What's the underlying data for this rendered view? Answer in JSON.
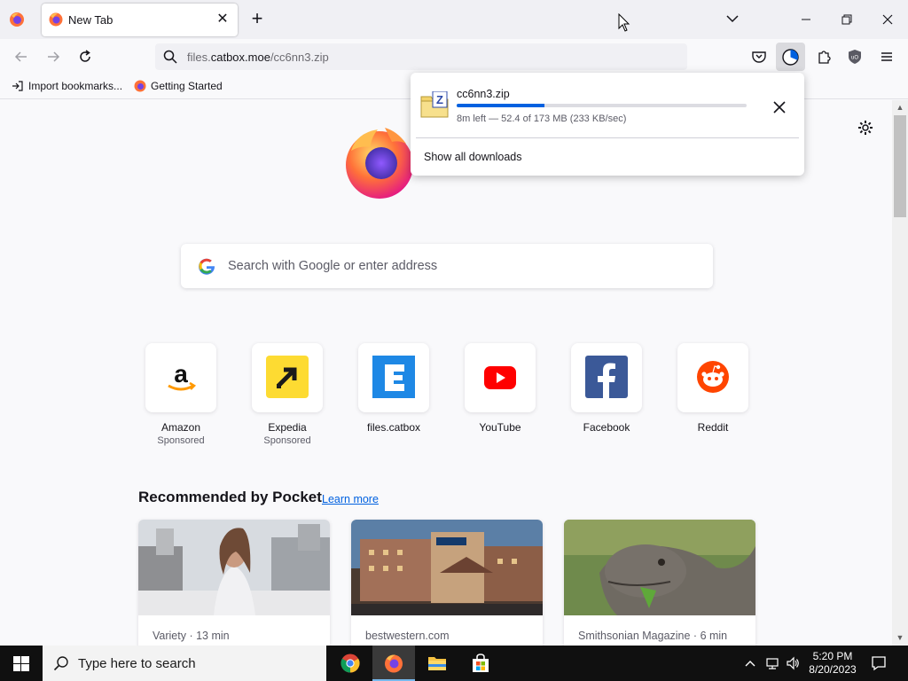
{
  "browser": {
    "tab": {
      "title": "New Tab",
      "close_glyph": "✕"
    },
    "new_tab_glyph": "+",
    "url": {
      "prefix": "files.",
      "host": "catbox.moe",
      "path": "/cc6nn3.zip"
    }
  },
  "bookmarks": [
    {
      "label": "Import bookmarks...",
      "icon": "import-icon"
    },
    {
      "label": "Getting Started",
      "icon": "firefox-icon"
    }
  ],
  "downloads_panel": {
    "file_name": "cc6nn3.zip",
    "status": "8m left — 52.4 of 173 MB (233 KB/sec)",
    "progress_fraction": 0.303,
    "show_all_label": "Show all downloads"
  },
  "newtab": {
    "search_placeholder": "Search with Google or enter address",
    "top_sites": [
      {
        "name": "Amazon",
        "sponsor": "Sponsored",
        "icon": "amazon-icon"
      },
      {
        "name": "Expedia",
        "sponsor": "Sponsored",
        "icon": "expedia-icon"
      },
      {
        "name": "files.catbox",
        "sponsor": "",
        "icon": "catbox-icon"
      },
      {
        "name": "YouTube",
        "sponsor": "",
        "icon": "youtube-icon"
      },
      {
        "name": "Facebook",
        "sponsor": "",
        "icon": "facebook-icon"
      },
      {
        "name": "Reddit",
        "sponsor": "",
        "icon": "reddit-icon"
      }
    ],
    "pocket": {
      "title": "Recommended by Pocket",
      "learn_more": "Learn more",
      "cards": [
        {
          "source": "Variety · 13 min"
        },
        {
          "source": "bestwestern.com"
        },
        {
          "source": "Smithsonian Magazine · 6 min"
        }
      ]
    }
  },
  "taskbar": {
    "search_placeholder": "Type here to search",
    "time": "5:20 PM",
    "date": "8/20/2023"
  },
  "colors": {
    "accent": "#0061e0",
    "taskbar": "#101010"
  }
}
